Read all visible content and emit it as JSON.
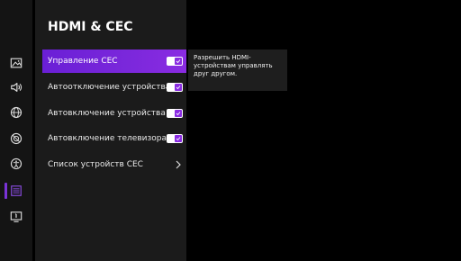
{
  "panel": {
    "title": "HDMI & CEC",
    "items": [
      {
        "label": "Управление CEC",
        "control": "toggle",
        "checked": true,
        "active": true
      },
      {
        "label": "Автоотключение устройства",
        "control": "toggle",
        "checked": true,
        "active": false
      },
      {
        "label": "Автовключение устройства",
        "control": "toggle",
        "checked": true,
        "active": false
      },
      {
        "label": "Автовключение телевизора",
        "control": "toggle",
        "checked": true,
        "active": false
      },
      {
        "label": "Список устройств CEC",
        "control": "chevron",
        "active": false
      }
    ]
  },
  "tooltip": {
    "text": "Разрешить HDMI-устройствам управлять друг другом."
  },
  "rail": {
    "icons": [
      "picture-icon",
      "sound-icon",
      "network-icon",
      "general-icon",
      "accessibility-icon",
      "hdmi-cec-icon",
      "system-info-icon"
    ],
    "active_icon": "hdmi-cec-icon"
  },
  "colors": {
    "accent": "#8a2be2",
    "background": "#000000",
    "panel": "#1b1b1b"
  }
}
